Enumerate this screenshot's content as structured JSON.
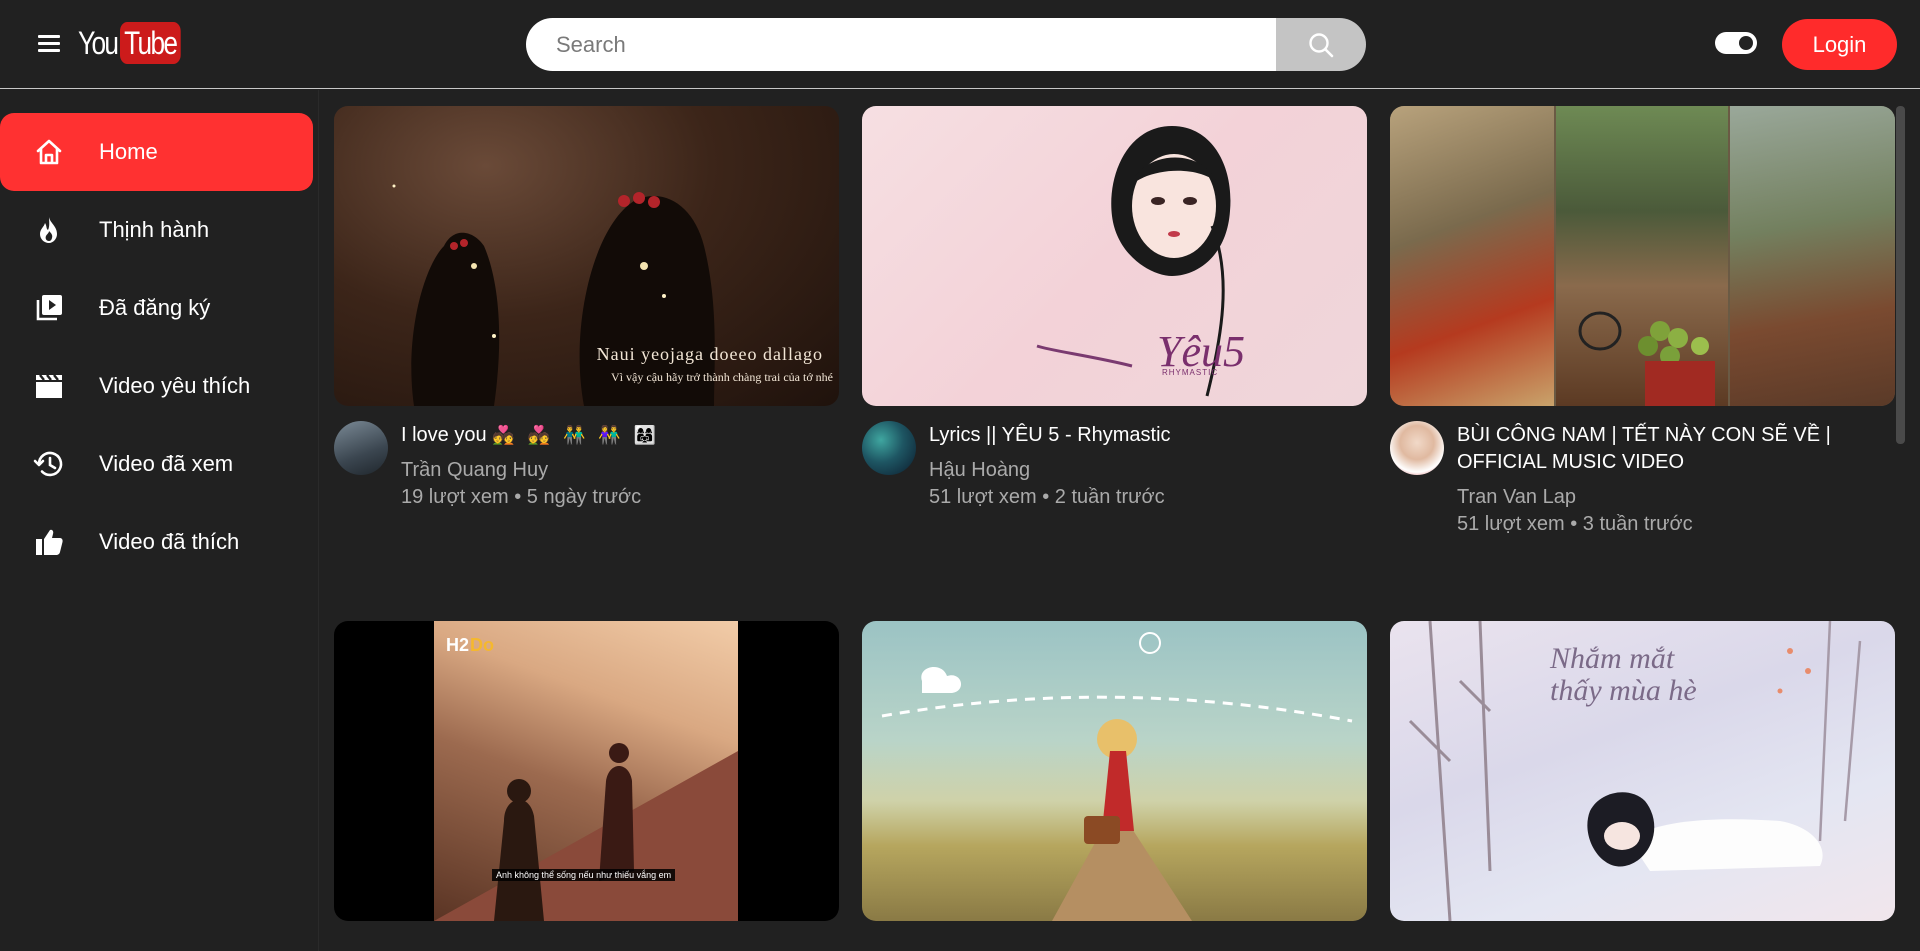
{
  "header": {
    "logo_you": "You",
    "logo_tube": "Tube",
    "search_placeholder": "Search",
    "login_label": "Login"
  },
  "sidebar": {
    "items": [
      {
        "label": "Home",
        "icon": "home-icon"
      },
      {
        "label": "Thịnh hành",
        "icon": "flame-icon"
      },
      {
        "label": "Đã đăng ký",
        "icon": "subscriptions-icon"
      },
      {
        "label": "Video yêu thích",
        "icon": "clapperboard-icon"
      },
      {
        "label": "Video đã xem",
        "icon": "history-icon"
      },
      {
        "label": "Video đã thích",
        "icon": "thumbs-up-icon"
      }
    ]
  },
  "videos": [
    {
      "title": "I love you",
      "title_emojis": "💑 💑 👬 👫 👩‍👩‍👧",
      "channel": "Trần Quang Huy",
      "meta": "19 lượt xem • 5 ngày trước",
      "thumb_caption1": "Naui yeojaga doeeo dallago",
      "thumb_caption2": "Vì vậy cậu hãy trở thành chàng trai của tớ nhé"
    },
    {
      "title": "Lyrics || YÊU 5 - Rhymastic",
      "channel": "Hậu Hoàng",
      "meta": "51 lượt xem • 2 tuần trước",
      "thumb_caption1": "Yêu5",
      "thumb_caption2": "RHYMASTIC"
    },
    {
      "title": "BÙI CÔNG NAM | TẾT NÀY CON SẼ VỀ | OFFICIAL MUSIC VIDEO",
      "channel": "Tran Van Lap",
      "meta": "51 lượt xem • 3 tuần trước"
    },
    {
      "title": "",
      "channel": "",
      "meta": "",
      "thumb_caption1": "Anh không thể sống nếu như thiếu vắng em"
    },
    {
      "title": "",
      "channel": "",
      "meta": ""
    },
    {
      "title": "",
      "channel": "",
      "meta": "",
      "thumb_caption1": "Nhắm mắt thấy mùa hè"
    }
  ],
  "colors": {
    "background": "#212121",
    "accent": "#ff3131",
    "search_button": "#c4c4c4",
    "muted_text": "#aaaaaa"
  }
}
